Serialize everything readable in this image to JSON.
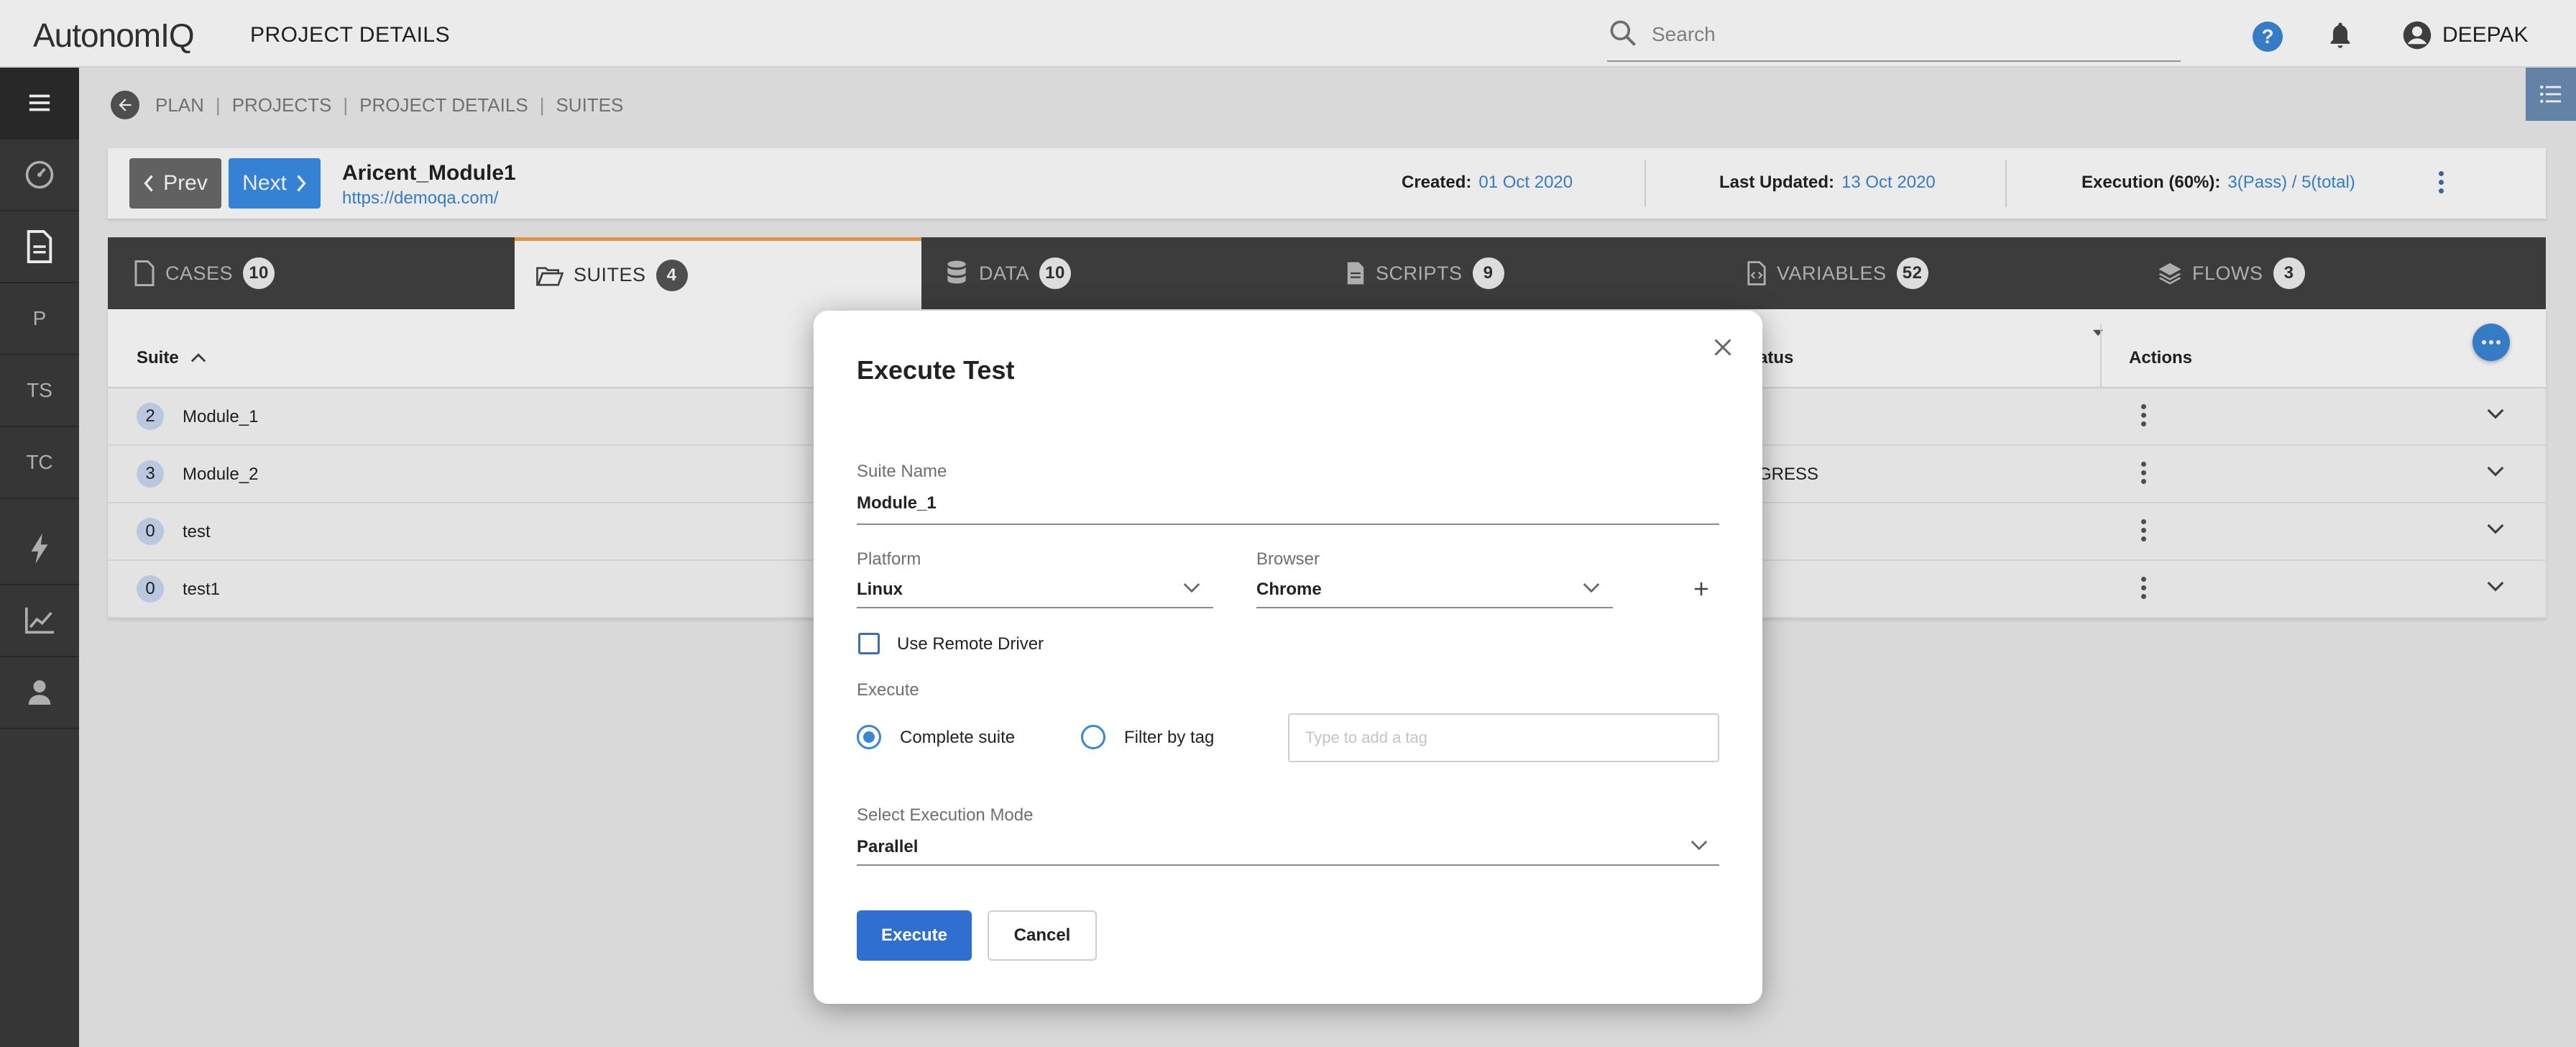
{
  "header": {
    "logo_text": "AutonomIQ",
    "page_title": "PROJECT DETAILS",
    "search_placeholder": "Search",
    "user_name": "DEEPAK"
  },
  "sidebar": {
    "items": [
      {
        "icon": "menu-icon"
      },
      {
        "icon": "dashboard-icon"
      },
      {
        "icon": "document-icon"
      },
      {
        "label": "P"
      },
      {
        "label": "TS"
      },
      {
        "label": "TC"
      },
      {
        "icon": "lightning-icon"
      },
      {
        "icon": "chart-icon"
      },
      {
        "icon": "user-icon"
      }
    ]
  },
  "breadcrumb": [
    "PLAN",
    "PROJECTS",
    "PROJECT DETAILS",
    "SUITES"
  ],
  "project": {
    "prev_label": "Prev",
    "next_label": "Next",
    "name": "Aricent_Module1",
    "url": "https://demoqa.com/",
    "created_label": "Created:",
    "created_value": "01 Oct 2020",
    "updated_label": "Last Updated:",
    "updated_value": "13 Oct 2020",
    "execution_label": "Execution (60%):",
    "execution_value": "3(Pass) / 5(total)"
  },
  "tabs": [
    {
      "label": "CASES",
      "count": "10"
    },
    {
      "label": "SUITES",
      "count": "4"
    },
    {
      "label": "DATA",
      "count": "10"
    },
    {
      "label": "SCRIPTS",
      "count": "9"
    },
    {
      "label": "VARIABLES",
      "count": "52"
    },
    {
      "label": "FLOWS",
      "count": "3"
    }
  ],
  "table": {
    "col_suite": "Suite",
    "col_status": "atus",
    "col_actions": "Actions",
    "rows": [
      {
        "count": "2",
        "name": "Module_1",
        "status": ""
      },
      {
        "count": "3",
        "name": "Module_2",
        "status": "GRESS"
      },
      {
        "count": "0",
        "name": "test",
        "status": ""
      },
      {
        "count": "0",
        "name": "test1",
        "status": ""
      }
    ]
  },
  "modal": {
    "title": "Execute Test",
    "suite_name_label": "Suite Name",
    "suite_name_value": "Module_1",
    "platform_label": "Platform",
    "platform_value": "Linux",
    "browser_label": "Browser",
    "browser_value": "Chrome",
    "remote_driver_label": "Use Remote Driver",
    "execute_label": "Execute",
    "complete_suite_label": "Complete suite",
    "filter_tag_label": "Filter by tag",
    "tag_placeholder": "Type to add a tag",
    "mode_label": "Select Execution Mode",
    "mode_value": "Parallel",
    "execute_button": "Execute",
    "cancel_button": "Cancel"
  },
  "colors": {
    "accent_blue": "#3a86d6",
    "tab_active_border": "#f0a04b",
    "sidebar_bg": "#3b3b3b",
    "tab_bar_bg": "#424242"
  }
}
